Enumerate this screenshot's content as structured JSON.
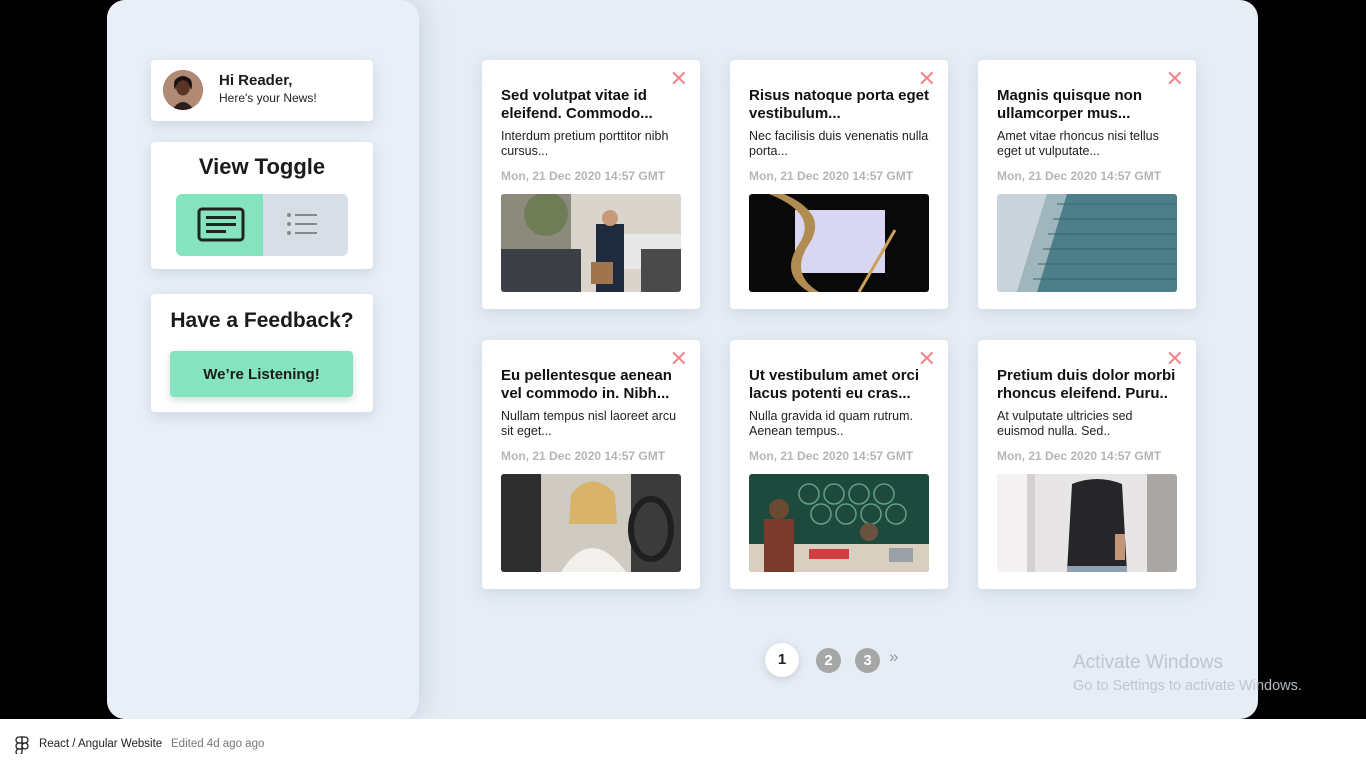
{
  "greeting": {
    "title": "Hi Reader,",
    "subtitle": "Here's your News!"
  },
  "view_toggle": {
    "title": "View Toggle",
    "active": "grid"
  },
  "feedback": {
    "title": "Have a Feedback?",
    "button_label": "We’re Listening!"
  },
  "news": [
    {
      "title": "Sed volutpat vitae id eleifend. Commodo...",
      "description": "Interdum pretium porttitor nibh cursus...",
      "date": "Mon, 21 Dec 2020 14:57 GMT",
      "image": "businessman-at-car"
    },
    {
      "title": "Risus natoque porta eget vestibulum...",
      "description": "Nec facilisis duis venenatis nulla porta...",
      "date": "Mon, 21 Dec 2020 14:57 GMT",
      "image": "paper-and-pen"
    },
    {
      "title": "Magnis quisque non ullamcorper mus...",
      "description": "Amet vitae rhoncus nisi tellus eget ut vulputate...",
      "date": "Mon, 21 Dec 2020 14:57 GMT",
      "image": "glass-skyscraper"
    },
    {
      "title": "Eu pellentesque aenean vel commodo in. Nibh...",
      "description": "Nullam tempus nisl laoreet arcu sit eget...",
      "date": "Mon, 21 Dec 2020 14:57 GMT",
      "image": "woman-driving-phone"
    },
    {
      "title": "Ut vestibulum amet orci lacus potenti eu cras...",
      "description": "Nulla gravida id quam rutrum. Aenean tempus..",
      "date": "Mon, 21 Dec 2020 14:57 GMT",
      "image": "market-vendors"
    },
    {
      "title": "Pretium duis dolor morbi rhoncus eleifend. Puru..",
      "description": "At vulputate ultricies sed euismod nulla. Sed..",
      "date": "Mon, 21 Dec 2020 14:57 GMT",
      "image": "man-black-sweater"
    }
  ],
  "pagination": {
    "pages": [
      "1",
      "2",
      "3"
    ],
    "current": "1",
    "next": "»"
  },
  "watermark": {
    "title": "Activate Windows",
    "subtitle": "Go to Settings to activate Windows."
  },
  "footer": {
    "file_name": "React / Angular Website",
    "edited": "Edited 4d ago ago"
  },
  "colors": {
    "accent": "#86e3bf",
    "close": "#f08a8a",
    "date": "#b5b5b5",
    "background": "#e6edf5"
  }
}
